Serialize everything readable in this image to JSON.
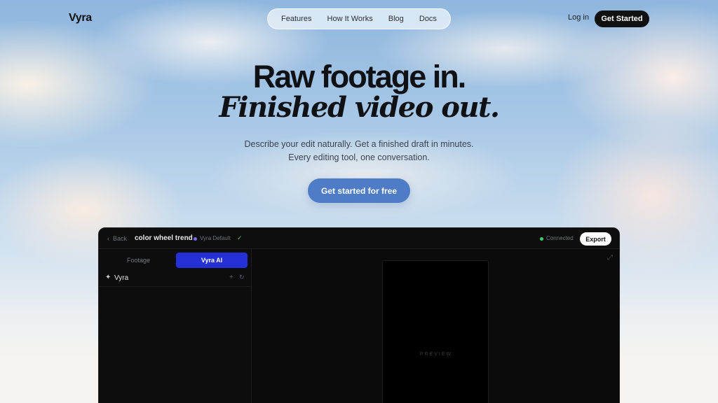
{
  "brand": {
    "logo": "Vyra"
  },
  "nav": {
    "links": [
      "Features",
      "How It Works",
      "Blog",
      "Docs"
    ],
    "login": "Log in",
    "cta": "Get Started"
  },
  "hero": {
    "title_line1": "Raw footage in.",
    "title_line2": "Finished video out.",
    "subtitle_line1": "Describe your edit naturally. Get a finished draft in minutes.",
    "subtitle_line2": "Every editing tool, one conversation.",
    "cta": "Get started for free"
  },
  "app": {
    "back": "Back",
    "project_name": "color wheel trend",
    "preset": "Vyra Default",
    "status": "Connected",
    "export": "Export",
    "tabs": {
      "footage": "Footage",
      "ai": "Vyra AI"
    },
    "chat_name": "Vyra",
    "preview_label": "PREVIEW"
  },
  "colors": {
    "accent_cta": "#4f7cc6",
    "ai_tab": "#2530d6",
    "status_dot": "#3ecf6a",
    "preset_dot": "#7c6cf0"
  }
}
